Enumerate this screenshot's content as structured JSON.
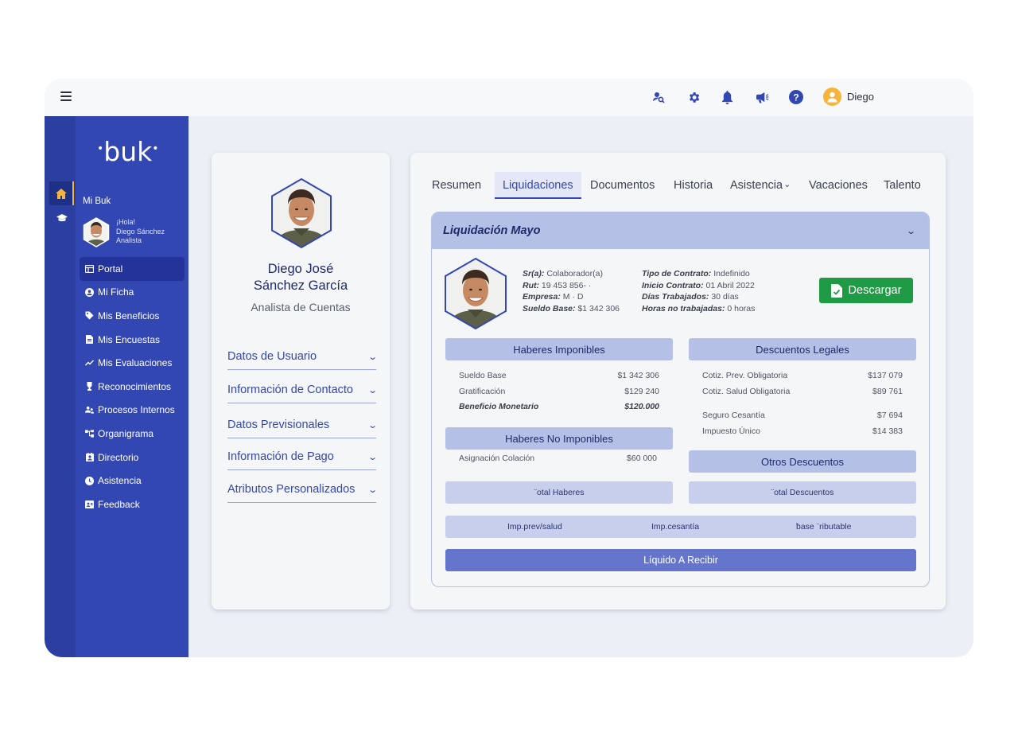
{
  "topbar": {
    "icons": [
      "user-search-icon",
      "gear-icon",
      "bell-icon",
      "megaphone-icon",
      "help-icon"
    ],
    "user_name": "Diego"
  },
  "brand": {
    "logo_text": "buk"
  },
  "sidebar": {
    "section_label": "Mi Buk",
    "greeting": "¡Hola!",
    "user_full": "Diego Sánchez",
    "user_role": "Analista",
    "items": [
      {
        "label": "Portal",
        "icon": "portal-icon"
      },
      {
        "label": "Mi Ficha",
        "icon": "user-circle-icon"
      },
      {
        "label": "Mis Beneficios",
        "icon": "tag-icon"
      },
      {
        "label": "Mis Encuestas",
        "icon": "document-icon"
      },
      {
        "label": "Mis Evaluaciones",
        "icon": "trend-icon"
      },
      {
        "label": "Reconocimientos",
        "icon": "trophy-icon"
      },
      {
        "label": "Procesos Internos",
        "icon": "people-icon"
      },
      {
        "label": "Organigrama",
        "icon": "org-chart-icon"
      },
      {
        "label": "Directorio",
        "icon": "contacts-icon"
      },
      {
        "label": "Asistencia",
        "icon": "clock-icon"
      },
      {
        "label": "Feedback",
        "icon": "feedback-icon"
      }
    ]
  },
  "profile": {
    "name_line1": "Diego José",
    "name_line2": "Sánchez García",
    "role": "Analista de Cuentas",
    "sections": [
      "Datos de Usuario",
      "Información de Contacto",
      "Datos Previsionales",
      "Información de Pago",
      "Atributos Personalizados"
    ]
  },
  "tabs": [
    "Resumen",
    "Liquidaciones",
    "Documentos",
    "Historia",
    "Asistencia",
    "Vacaciones",
    "Talento"
  ],
  "tab_dropdown_mark": "⌄",
  "liquidacion": {
    "title": "Liquidación Mayo",
    "info_left": [
      {
        "label": "Sr(a):",
        "value": "Colaborador(a)"
      },
      {
        "label": "Rut:",
        "value": "19 453 856-  ·"
      },
      {
        "label": "Empresa:",
        "value": "M ·  D"
      },
      {
        "label": "Sueldo Base:",
        "value": "$1 342 306"
      }
    ],
    "info_right": [
      {
        "label": "Tipo de Contrato:",
        "value": "Indefinido"
      },
      {
        "label": "Inicio Contrato:",
        "value": "01 Abril 2022"
      },
      {
        "label": "Días Trabajados:",
        "value": "30 días"
      },
      {
        "label": "Horas no trabajadas:",
        "value": "0 horas"
      }
    ],
    "download_label": "Descargar",
    "haberes_imponibles": {
      "title": "Haberes Imponibles",
      "rows": [
        {
          "label": "Sueldo Base",
          "value": "$1 342 306"
        },
        {
          "label": "Gratificación",
          "value": "$129 240"
        },
        {
          "label": "Beneficio Monetario",
          "value": "$120.000"
        }
      ]
    },
    "haberes_no_imponibles": {
      "title": "Haberes  No Imponibles",
      "rows": [
        {
          "label": "Asignación Colación",
          "value": "$60 000"
        }
      ]
    },
    "descuentos_legales": {
      "title": "Descuentos Legales",
      "rows": [
        {
          "label": "Cotiz. Prev. Obligatoria",
          "value": "$137 079"
        },
        {
          "label": "Cotiz. Salud Obligatoria",
          "value": "$89 761"
        },
        {
          "label": "Seguro Cesantía",
          "value": "$7 694"
        },
        {
          "label": "Impuesto Único",
          "value": "$14 383"
        }
      ]
    },
    "otros_descuentos": {
      "title": "Otros Descuentos"
    },
    "total_haberes": "¨otal Haberes",
    "total_descuentos": "¨otal Descuentos",
    "imp_prev_salud": "Imp.prev/salud",
    "imp_cesantia": "Imp.cesantía",
    "base_tributable": "ƀase ¨ributable",
    "liquido": "Líquido A Recibir"
  },
  "colors": {
    "primary": "#3347b3",
    "rail": "#2a3fa0",
    "accent": "#f6b43c",
    "download": "#1f9b46",
    "section": "#b5c0e6"
  }
}
